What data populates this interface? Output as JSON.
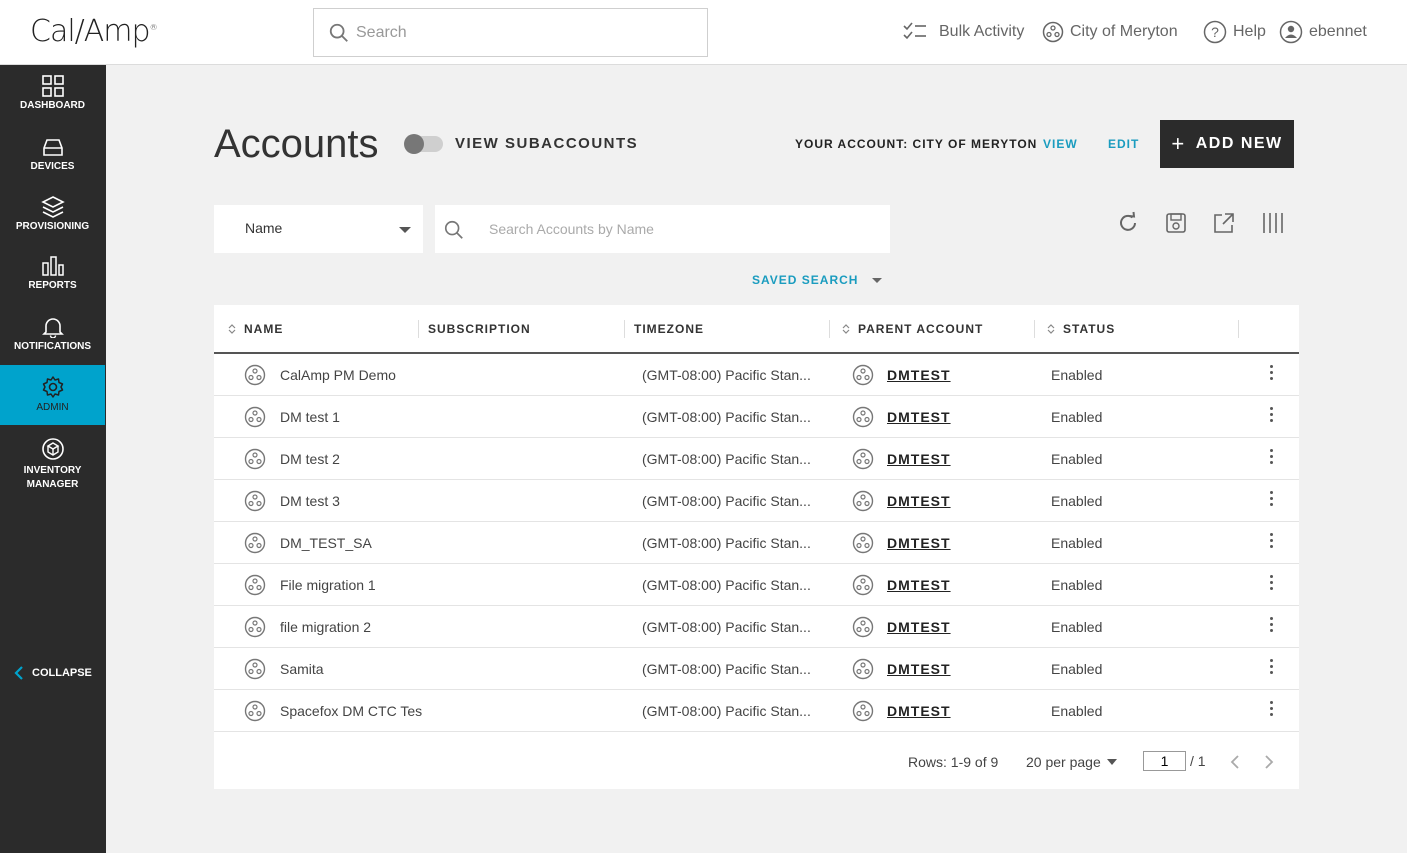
{
  "header": {
    "logo": "Cal/Amp",
    "search_placeholder": "Search",
    "bulk_activity": "Bulk Activity",
    "account_switch": "City of Meryton",
    "help": "Help",
    "user": "ebennet"
  },
  "sidebar": {
    "items": [
      {
        "label": "DASHBOARD",
        "icon": "dashboard-icon"
      },
      {
        "label": "DEVICES",
        "icon": "devices-icon"
      },
      {
        "label": "PROVISIONING",
        "icon": "provisioning-icon"
      },
      {
        "label": "REPORTS",
        "icon": "reports-icon"
      },
      {
        "label": "NOTIFICATIONS",
        "icon": "bell-icon"
      },
      {
        "label": "ADMIN",
        "icon": "gear-icon"
      },
      {
        "label": "INVENTORY",
        "label2": "MANAGER",
        "icon": "inventory-icon"
      }
    ],
    "active_index": 5,
    "collapse_label": "COLLAPSE"
  },
  "page": {
    "title": "Accounts",
    "view_subaccounts": "VIEW SUBACCOUNTS",
    "your_account": "YOUR ACCOUNT: CITY OF MERYTON",
    "view": "VIEW",
    "edit": "EDIT",
    "add_new": "ADD NEW"
  },
  "filter": {
    "field": "Name",
    "search_placeholder": "Search Accounts by Name",
    "saved_search": "SAVED SEARCH"
  },
  "toolbar": [
    "refresh-icon",
    "save-icon",
    "export-icon",
    "columns-icon"
  ],
  "table": {
    "columns": [
      "NAME",
      "SUBSCRIPTION",
      "TIMEZONE",
      "PARENT ACCOUNT",
      "STATUS"
    ],
    "rows": [
      {
        "name": "CalAmp PM Demo",
        "subscription": "",
        "timezone": "(GMT-08:00) Pacific Stan...",
        "parent": "DMTEST",
        "status": "Enabled"
      },
      {
        "name": "DM test 1",
        "subscription": "",
        "timezone": "(GMT-08:00) Pacific Stan...",
        "parent": "DMTEST",
        "status": "Enabled"
      },
      {
        "name": "DM test 2",
        "subscription": "",
        "timezone": "(GMT-08:00) Pacific Stan...",
        "parent": "DMTEST",
        "status": "Enabled"
      },
      {
        "name": "DM test 3",
        "subscription": "",
        "timezone": "(GMT-08:00) Pacific Stan...",
        "parent": "DMTEST",
        "status": "Enabled"
      },
      {
        "name": "DM_TEST_SA",
        "subscription": "",
        "timezone": "(GMT-08:00) Pacific Stan...",
        "parent": "DMTEST",
        "status": "Enabled"
      },
      {
        "name": "File migration 1",
        "subscription": "",
        "timezone": "(GMT-08:00) Pacific Stan...",
        "parent": "DMTEST",
        "status": "Enabled"
      },
      {
        "name": "file migration 2",
        "subscription": "",
        "timezone": "(GMT-08:00) Pacific Stan...",
        "parent": "DMTEST",
        "status": "Enabled"
      },
      {
        "name": "Samita",
        "subscription": "",
        "timezone": "(GMT-08:00) Pacific Stan...",
        "parent": "DMTEST",
        "status": "Enabled"
      },
      {
        "name": "Spacefox DM CTC Test",
        "subscription": "",
        "timezone": "(GMT-08:00) Pacific Stan...",
        "parent": "DMTEST",
        "status": "Enabled"
      }
    ]
  },
  "pagination": {
    "rows": "Rows: 1-9 of 9",
    "per_page": "20 per page",
    "page": "1",
    "total": "/ 1"
  },
  "colors": {
    "accent": "#00a3cc",
    "link": "#1a9cbf",
    "sidebar": "#2b2b2b",
    "button": "#2b2b2b"
  }
}
